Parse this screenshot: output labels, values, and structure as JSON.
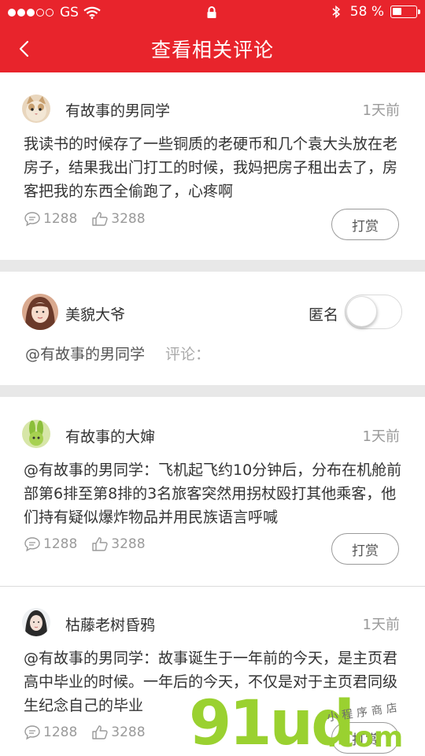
{
  "status_bar": {
    "carrier": "GS",
    "battery_text": "58 %",
    "battery_level": 0.4
  },
  "nav": {
    "title": "查看相关评论"
  },
  "comments": [
    {
      "user": "有故事的男同学",
      "time": "1天前",
      "text": "我读书的时候存了一些铜质的老硬币和几个袁大头放在老房子，结果我出门打工的时候，我妈把房子租出去了，房客把我的东西全偷跑了，心疼啊",
      "comments_count": "1288",
      "likes_count": "3288",
      "reward_label": "打赏"
    },
    {
      "user": "有故事的大婶",
      "time": "1天前",
      "text": "@有故事的男同学：飞机起飞约10分钟后，分布在机舱前部第6排至第8排的3名旅客突然用拐杖殴打其他乘客，他们持有疑似爆炸物品并用民族语言呼喊",
      "comments_count": "1288",
      "likes_count": "3288",
      "reward_label": "打赏"
    },
    {
      "user": "枯藤老树昏鸦",
      "time": "1天前",
      "text": "@有故事的男同学：故事诞生于一年前的今天，是主页君高中毕业的时候。一年后的今天，不仅是对于主页君同级生纪念自己的毕业",
      "comments_count": "1288",
      "likes_count": "3288",
      "reward_label": "打赏"
    }
  ],
  "composer": {
    "user": "美貌大爷",
    "anon_label": "匿名",
    "anon_on": false,
    "mention": "@有故事的男同学",
    "hint": "评论："
  },
  "watermark": {
    "main": "91ud",
    "suffix": ".com",
    "tagline": "小程序商店"
  }
}
